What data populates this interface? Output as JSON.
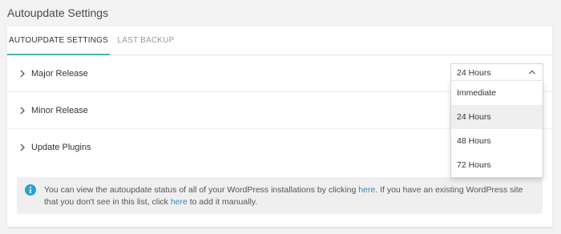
{
  "page": {
    "title": "Autoupdate Settings"
  },
  "tabs": [
    {
      "label": "AUTOUPDATE SETTINGS",
      "active": true
    },
    {
      "label": "LAST BACKUP",
      "active": false
    }
  ],
  "rows": [
    {
      "label": "Major Release"
    },
    {
      "label": "Minor Release"
    },
    {
      "label": "Update Plugins"
    }
  ],
  "select": {
    "value": "24 Hours",
    "options": [
      "Immediate",
      "24 Hours",
      "48 Hours",
      "72 Hours"
    ],
    "selected_index": 1
  },
  "notice": {
    "icon": "info-icon",
    "part1": "You can view the autoupdate status of all of your WordPress installations by clicking ",
    "link1": "here",
    "part2": ". If you have an existing WordPress site that you don't see in this list, click ",
    "link2": "here",
    "part3": " to add it manually."
  },
  "colors": {
    "accent": "#3fb5b5",
    "link": "#2c8fbd",
    "info_icon": "#2a9fd6"
  }
}
